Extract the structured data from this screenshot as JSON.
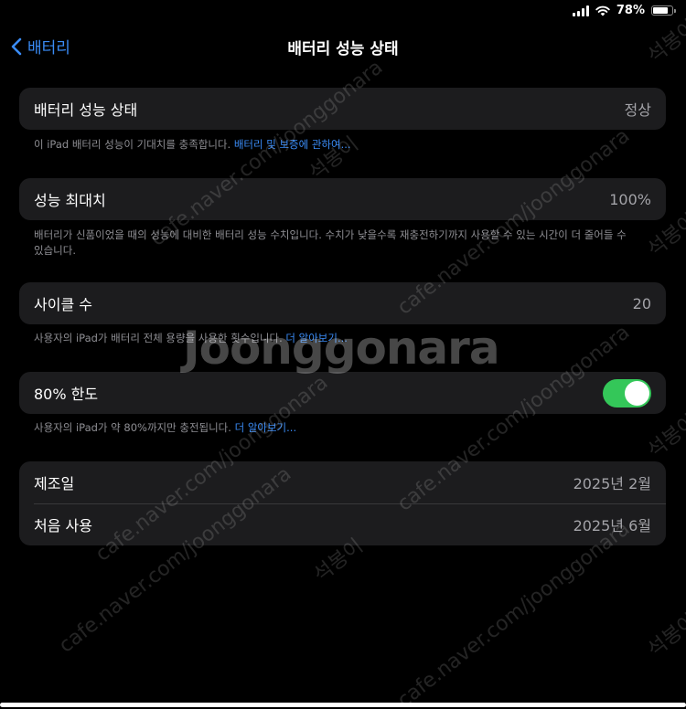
{
  "status_bar": {
    "battery_percent": "78%",
    "battery_level": 0.78
  },
  "nav": {
    "back_label": "배터리",
    "title": "배터리 성능 상태"
  },
  "sections": {
    "health": {
      "label": "배터리 성능 상태",
      "value": "정상",
      "footer_text": "이 iPad 배터리 성능이 기대치를 충족합니다. ",
      "footer_link": "배터리 및 보증에 관하여..."
    },
    "max_capacity": {
      "label": "성능 최대치",
      "value": "100%",
      "footer_text": "배터리가 신품이었을 때의 성능에 대비한 배터리 성능 수치입니다. 수치가 낮을수록 재충전하기까지 사용할 수 있는 시간이 더 줄어들 수 있습니다."
    },
    "cycle_count": {
      "label": "사이클 수",
      "value": "20",
      "footer_text": "사용자의 iPad가 배터리 전체 용량을 사용한 횟수입니다. ",
      "footer_link": "더 알아보기..."
    },
    "limit_80": {
      "label": "80% 한도",
      "enabled": true,
      "footer_text": "사용자의 iPad가 약 80%까지만 충전됩니다. ",
      "footer_link": "더 알아보기..."
    },
    "dates": {
      "manufacture_label": "제조일",
      "manufacture_value": "2025년 2월",
      "first_use_label": "처음 사용",
      "first_use_value": "2025년 6월"
    }
  },
  "watermark": {
    "logo": "Joonggonara",
    "url": "cafe.naver.com/joonggonara",
    "seller": "석봉이"
  },
  "colors": {
    "accent": "#3a8cf7",
    "toggle_on": "#34c759",
    "cell_bg": "#1c1c1e",
    "secondary_text": "#8e8e93"
  }
}
